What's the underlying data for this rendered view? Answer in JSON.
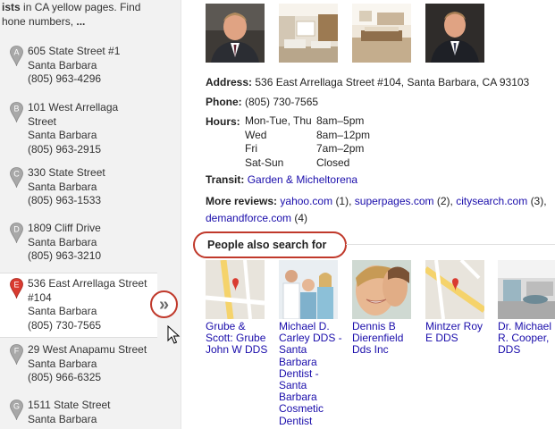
{
  "left": {
    "intro_line1_bold": "ists",
    "intro_line1_rest": " in CA yellow pages. Find",
    "intro_line2": "hone numbers, ",
    "intro_more": "...",
    "results": [
      {
        "letter": "A",
        "address": "605 State Street #1",
        "city": "Santa Barbara",
        "phone": "(805) 963-4296"
      },
      {
        "letter": "B",
        "address": "101 West Arrellaga Street",
        "city": "Santa Barbara",
        "phone": "(805) 963-2915"
      },
      {
        "letter": "C",
        "address": "330 State Street",
        "city": "Santa Barbara",
        "phone": "(805) 963-1533"
      },
      {
        "letter": "D",
        "address": "1809 Cliff Drive",
        "city": "Santa Barbara",
        "phone": "(805) 963-3210"
      },
      {
        "letter": "E",
        "address": "536 East Arrellaga Street #104",
        "city": "Santa Barbara",
        "phone": "(805) 730-7565"
      },
      {
        "letter": "F",
        "address": "29 West Anapamu Street",
        "city": "Santa Barbara",
        "phone": "(805) 966-6325"
      },
      {
        "letter": "G",
        "address": "1511 State Street",
        "city": "Santa Barbara",
        "phone": ""
      }
    ],
    "expand_glyph": "»"
  },
  "details": {
    "address_label": "Address:",
    "address": "536 East Arrellaga Street #104, Santa Barbara, CA 93103",
    "phone_label": "Phone:",
    "phone": "(805) 730-7565",
    "hours_label": "Hours:",
    "hours": [
      {
        "day": "Mon-Tue, Thu",
        "time": "8am–5pm"
      },
      {
        "day": "Wed",
        "time": "8am–12pm"
      },
      {
        "day": "Fri",
        "time": "7am–2pm"
      },
      {
        "day": "Sat-Sun",
        "time": "Closed"
      }
    ],
    "transit_label": "Transit:",
    "transit": "Garden & Micheltorena",
    "reviews_label": "More reviews:",
    "reviews": [
      {
        "site": "yahoo.com",
        "count": "(1),"
      },
      {
        "site": "superpages.com",
        "count": "(2),"
      },
      {
        "site": "citysearch.com",
        "count": "(3),"
      },
      {
        "site": "demandforce.com",
        "count": "(4)"
      }
    ]
  },
  "people": {
    "title": "People also search for",
    "items": [
      {
        "name": "Grube & Scott: Grube John W DDS",
        "kind": "map"
      },
      {
        "name": "Michael D. Carley DDS - Santa Barbara Dentist - Santa Barbara Cosmetic Dentist",
        "kind": "team"
      },
      {
        "name": "Dennis B Dierenfield Dds Inc",
        "kind": "smile"
      },
      {
        "name": "Mintzer Roy E DDS",
        "kind": "map"
      },
      {
        "name": "Dr. Michael R. Cooper, DDS",
        "kind": "office"
      }
    ]
  },
  "colors": {
    "link": "#1a0dab",
    "highlight_ring": "#c0392b",
    "active_pin": "#d93b30",
    "pin": "#a8a8a8"
  }
}
